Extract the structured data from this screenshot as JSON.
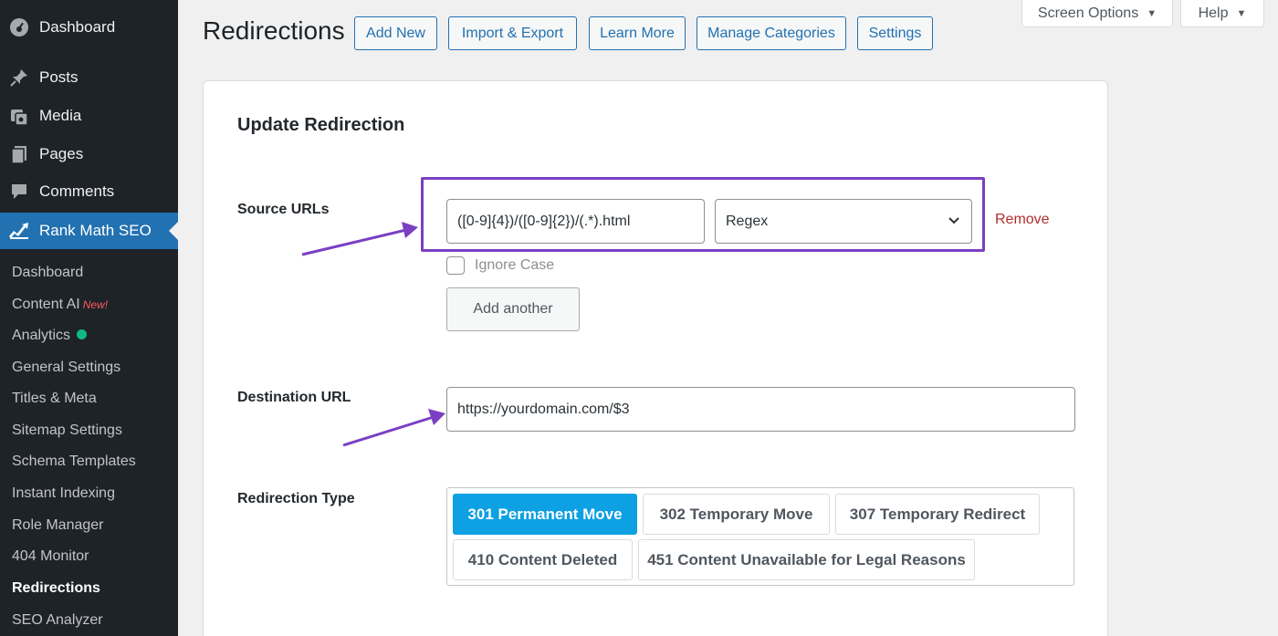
{
  "sidebar": {
    "top_items": [
      {
        "label": "Dashboard",
        "icon": "dashboard-icon"
      },
      {
        "label": "Posts",
        "icon": "pin-icon"
      },
      {
        "label": "Media",
        "icon": "media-icon"
      },
      {
        "label": "Pages",
        "icon": "pages-icon"
      },
      {
        "label": "Comments",
        "icon": "comments-icon"
      },
      {
        "label": "Rank Math SEO",
        "icon": "rank-math-icon"
      }
    ],
    "sub_items": [
      {
        "label": "Dashboard"
      },
      {
        "label": "Content AI",
        "badge": "New!"
      },
      {
        "label": "Analytics"
      },
      {
        "label": "General Settings"
      },
      {
        "label": "Titles & Meta"
      },
      {
        "label": "Sitemap Settings"
      },
      {
        "label": "Schema Templates"
      },
      {
        "label": "Instant Indexing"
      },
      {
        "label": "Role Manager"
      },
      {
        "label": "404 Monitor"
      },
      {
        "label": "Redirections"
      },
      {
        "label": "SEO Analyzer"
      }
    ]
  },
  "header": {
    "title": "Redirections",
    "buttons": [
      "Add New",
      "Import & Export",
      "Learn More",
      "Manage Categories",
      "Settings"
    ],
    "screen_options": "Screen Options",
    "help": "Help"
  },
  "form": {
    "title": "Update Redirection",
    "source_label": "Source URLs",
    "source_value": "([0-9]{4})/([0-9]{2})/(.*).html",
    "match_type": "Regex",
    "remove": "Remove",
    "ignore_case": "Ignore Case",
    "add_another": "Add another",
    "destination_label": "Destination URL",
    "destination_value": "https://yourdomain.com/$3",
    "type_label": "Redirection Type",
    "types": [
      "301 Permanent Move",
      "302 Temporary Move",
      "307 Temporary Redirect",
      "410 Content Deleted",
      "451 Content Unavailable for Legal Reasons"
    ],
    "selected_type": "301 Permanent Move"
  },
  "colors": {
    "sidebar_bg": "#1d2327",
    "active_menu": "#2271b1",
    "highlight": "#7b3fc4",
    "selected_type": "#0da0e3",
    "remove": "#b32d2e"
  }
}
